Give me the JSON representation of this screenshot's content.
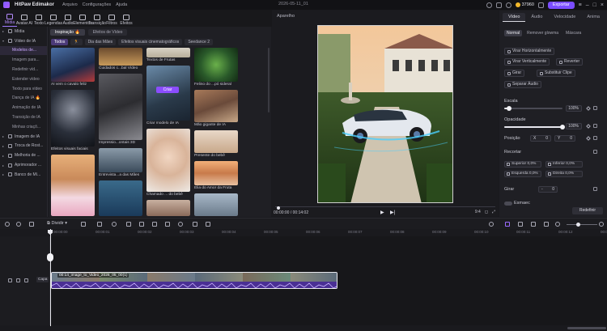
{
  "titlebar": {
    "app_name": "HitPaw Edimakor",
    "menu": [
      "Arquivo",
      "Configurações",
      "Ajuda"
    ],
    "date": "2026-05-11_01",
    "coins": "37960",
    "export_label": "Exportar"
  },
  "toolbar": {
    "tools": [
      {
        "label": "Mídia",
        "icon": "media-icon"
      },
      {
        "label": "Avatar AI",
        "icon": "avatar-icon"
      },
      {
        "label": "Texto",
        "icon": "text-icon"
      },
      {
        "label": "Legendas",
        "icon": "subtitles-icon"
      },
      {
        "label": "Áudio",
        "icon": "audio-icon"
      },
      {
        "label": "Elementos",
        "icon": "elements-icon"
      },
      {
        "label": "Transição",
        "icon": "transition-icon"
      },
      {
        "label": "Filtros",
        "icon": "filters-icon"
      },
      {
        "label": "Efeitos",
        "icon": "effects-icon"
      }
    ]
  },
  "sidebar": {
    "items": [
      {
        "label": "Mídia",
        "type": "group"
      },
      {
        "label": "Vídeo de IA",
        "type": "group-open"
      },
      {
        "label": "Modelos de...",
        "type": "sub",
        "active": true
      },
      {
        "label": "Imagem para...",
        "type": "sub"
      },
      {
        "label": "Redefinir víd...",
        "type": "sub"
      },
      {
        "label": "Estender vídeo",
        "type": "sub"
      },
      {
        "label": "Texto para vídeo",
        "type": "sub"
      },
      {
        "label": "Dança de IA 🔥",
        "type": "sub"
      },
      {
        "label": "Animação de IA",
        "type": "sub"
      },
      {
        "label": "Transição de IA",
        "type": "sub"
      },
      {
        "label": "Minhas criaçõ...",
        "type": "sub"
      },
      {
        "label": "Imagem de IA",
        "type": "group"
      },
      {
        "label": "Troca de Rost...",
        "type": "group"
      },
      {
        "label": "Melhoria de ...",
        "type": "group"
      },
      {
        "label": "Aprimorador ...",
        "type": "group"
      },
      {
        "label": "Banco de Mí...",
        "type": "group"
      }
    ]
  },
  "media": {
    "tabs": [
      "Inspiração 🔥",
      "Efeitos de Vídeo"
    ],
    "filters": [
      "Todos",
      "🏃",
      "Dia das Mães",
      "Efeitos visuais cinematográficos",
      "Seedance 2"
    ],
    "cards": {
      "col1": [
        "AI vem o cavalo feliz",
        "Efeitos visuais faciais",
        ""
      ],
      "col2": [
        "Cuidados c...bal Vídeo",
        "Impressio...ontais 3D",
        "Entrevista...a das Mães",
        ""
      ],
      "col3": [
        "Textos de Frutas",
        "Criar modelo de IA",
        "Chamado ... do bebê",
        ""
      ],
      "col4": [
        "Felino do ...pó sideral",
        "Mão gigante de IA",
        "Presente do bebê",
        "Elia do Amor da Fruta",
        ""
      ]
    },
    "create_label": "Criar"
  },
  "player": {
    "title": "Aparelho",
    "current_time": "00:00:00",
    "total_time": "00:14:02",
    "ratio": "9:4"
  },
  "rpanel": {
    "tabs": [
      "Vídeo",
      "Áudio",
      "Velocidade",
      "Anima"
    ],
    "subtabs": [
      "Normal",
      "Remover glowma",
      "Máscara"
    ],
    "buttons": {
      "flip_h": "Virar Horizontalmente",
      "flip_v": "Virar Verticalmente",
      "revert": "Reverter",
      "rotate": "Girar",
      "replace": "Substituir Clipe",
      "split_audio": "Separar Áudio"
    },
    "scale_label": "Escala",
    "scale_value": "100%",
    "scale_level": 0.08,
    "opacity_label": "Opacidade",
    "opacity_value": "100%",
    "opacity_level": 1.0,
    "position_label": "Posição",
    "pos_x_label": "X",
    "pos_x": "0",
    "pos_y_label": "Y",
    "pos_y": "0",
    "crop_label": "Recortar",
    "crop": {
      "top": "Superior 0,0%",
      "bottom": "Inferior 0,0%",
      "left": "Esquerda 0,0%",
      "right": "Direita 0,0%"
    },
    "rotate_label": "Girar",
    "rotate_value": "0",
    "fade_label": "Esmaec",
    "reset_label": "Redefinir"
  },
  "timeline": {
    "divide_label": "Dividir",
    "ruler": [
      "00:00:00",
      "00:00:01",
      "00:00:02",
      "00:00:03",
      "00:00:04",
      "00:00:05",
      "00:00:06",
      "00:00:07",
      "00:00:08",
      "00:00:09",
      "00:00:10",
      "00:00:11",
      "00:00:12",
      "00:00:13"
    ],
    "capa_label": "Capa",
    "clip_label": "00:14_image_to_Video_2026_05_00(1)"
  }
}
